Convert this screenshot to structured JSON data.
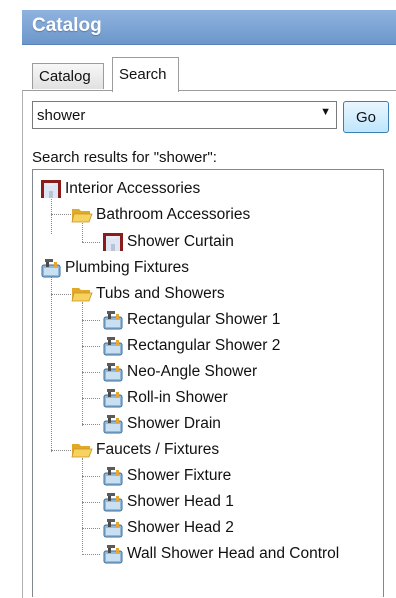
{
  "header": {
    "title": "Catalog"
  },
  "tabs": [
    {
      "label": "Catalog",
      "active": false
    },
    {
      "label": "Search",
      "active": true
    }
  ],
  "search": {
    "value": "shower",
    "go_label": "Go"
  },
  "results_label": "Search results for \"shower\":",
  "tree": [
    {
      "label": "Interior Accessories",
      "level": 0,
      "icon": "curtain-icon"
    },
    {
      "label": "Bathroom Accessories",
      "level": 1,
      "icon": "folder-open-icon"
    },
    {
      "label": "Shower Curtain",
      "level": 2,
      "icon": "curtain-icon"
    },
    {
      "label": "Plumbing Fixtures",
      "level": 0,
      "icon": "faucet-icon"
    },
    {
      "label": "Tubs and Showers",
      "level": 1,
      "icon": "folder-open-icon"
    },
    {
      "label": "Rectangular Shower 1",
      "level": 2,
      "icon": "faucet-icon"
    },
    {
      "label": "Rectangular Shower 2",
      "level": 2,
      "icon": "faucet-icon"
    },
    {
      "label": "Neo-Angle Shower",
      "level": 2,
      "icon": "faucet-icon"
    },
    {
      "label": "Roll-in Shower",
      "level": 2,
      "icon": "faucet-icon"
    },
    {
      "label": "Shower Drain",
      "level": 2,
      "icon": "faucet-icon"
    },
    {
      "label": "Faucets / Fixtures",
      "level": 1,
      "icon": "folder-open-icon"
    },
    {
      "label": "Shower Fixture",
      "level": 2,
      "icon": "faucet-icon"
    },
    {
      "label": "Shower Head 1",
      "level": 2,
      "icon": "faucet-icon"
    },
    {
      "label": "Shower Head 2",
      "level": 2,
      "icon": "faucet-icon"
    },
    {
      "label": "Wall Shower Head and Control",
      "level": 2,
      "icon": "faucet-icon"
    }
  ],
  "colors": {
    "header": "#7aa2d4",
    "folder": "#f3c94b",
    "curtain": "#8b1c1c",
    "faucet": "#4a86b5"
  }
}
